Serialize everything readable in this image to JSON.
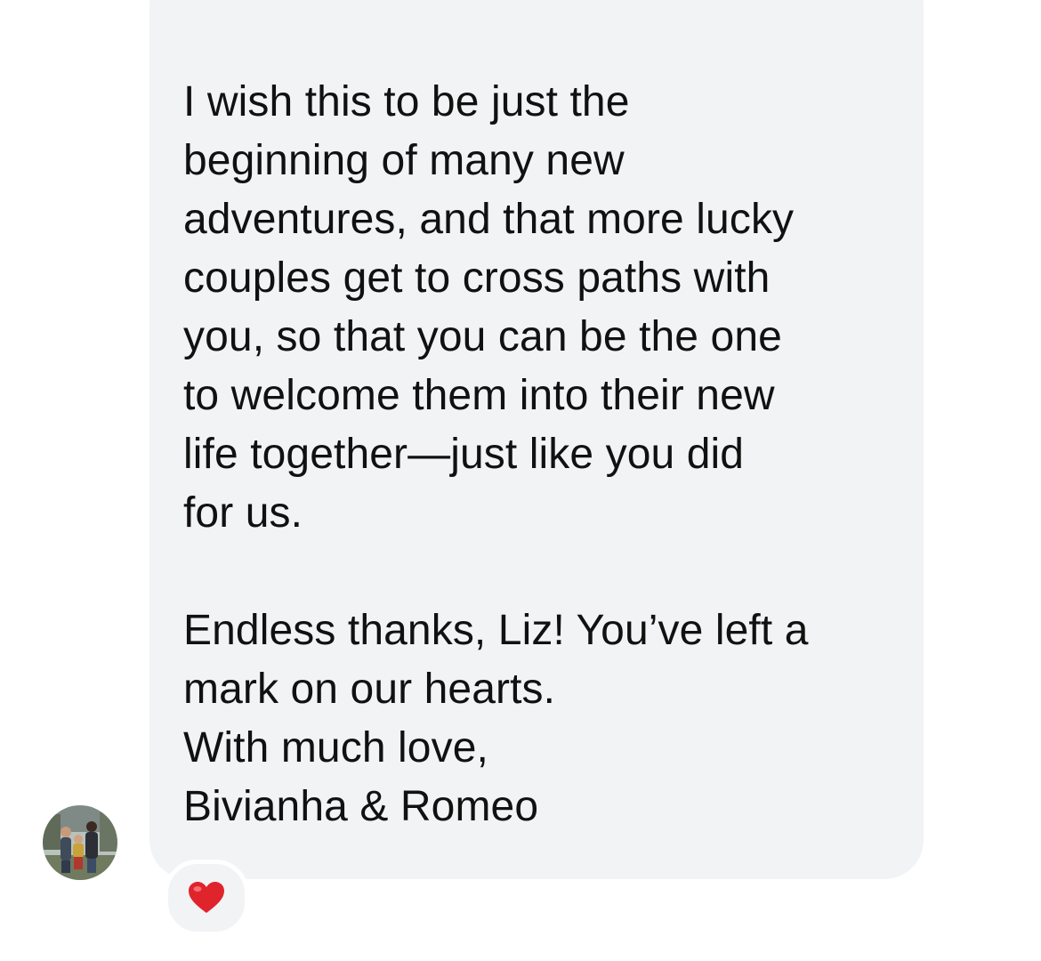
{
  "message": {
    "paragraph1": [
      "I wish this to be just the",
      "beginning of many new",
      "adventures, and that more lucky",
      "couples get to cross paths with",
      "you, so that you can be the one",
      "to welcome them into their new",
      "life together—just like you did",
      "for us."
    ],
    "paragraph2": [
      "Endless thanks, Liz! You’ve left a",
      "mark on our hearts.",
      "With much love,",
      "Bivianha & Romeo"
    ]
  },
  "sender": {
    "avatar_icon": "avatar-photo"
  },
  "reaction": {
    "icon": "heart-icon",
    "color": "#e0242c"
  },
  "colors": {
    "bubble": "#f2f3f5",
    "text": "#111111",
    "background": "#ffffff"
  }
}
